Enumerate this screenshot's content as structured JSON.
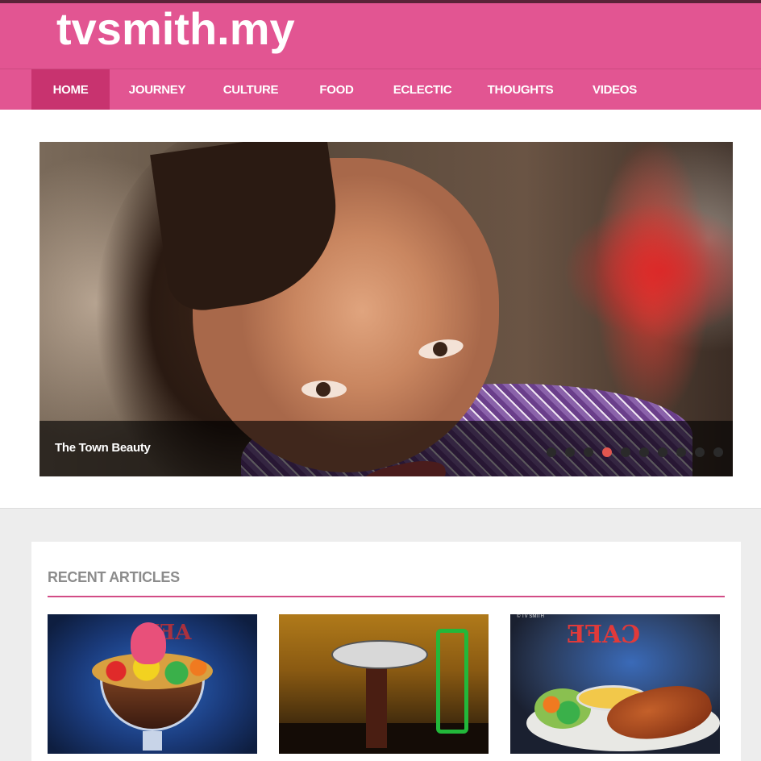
{
  "site": {
    "logo": "tvsmith.my"
  },
  "nav": {
    "items": [
      {
        "label": "HOME",
        "active": true
      },
      {
        "label": "JOURNEY"
      },
      {
        "label": "CULTURE"
      },
      {
        "label": "FOOD"
      },
      {
        "label": "ECLECTIC"
      },
      {
        "label": "THOUGHTS"
      },
      {
        "label": "VIDEOS"
      }
    ]
  },
  "slider": {
    "caption": "The Town Beauty",
    "dot_count": 10,
    "active_dot": 4
  },
  "recent": {
    "title": "RECENT ARTICLES",
    "thumb3_watermark": "© TV SMITH"
  },
  "colors": {
    "brand_pink": "#e25592",
    "nav_active": "#c8336f",
    "dot_active": "#e2564f",
    "rule": "#d24c86"
  }
}
